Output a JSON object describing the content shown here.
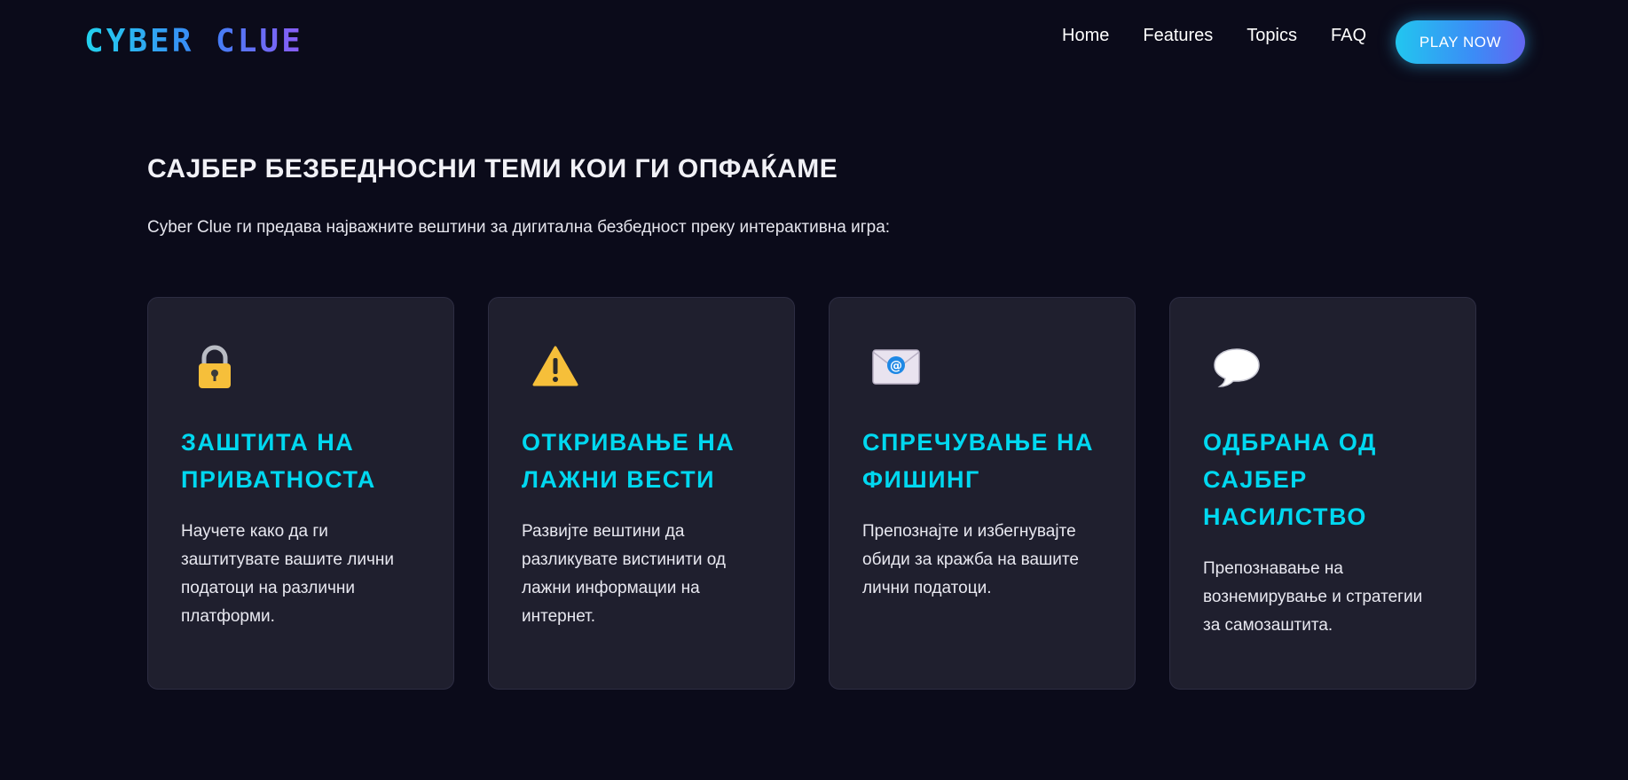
{
  "nav": {
    "logo": "CYBER CLUE",
    "links": [
      "Home",
      "Features",
      "Topics",
      "FAQ"
    ],
    "cta": "PLAY NOW"
  },
  "section": {
    "title": "САЈБЕР БЕЗБЕДНОСНИ ТЕМИ КОИ ГИ ОПФАЌАМЕ",
    "subtitle": "Cyber Clue ги предава најважните вештини за дигитална безбедност преку интерактивна игра:"
  },
  "cards": [
    {
      "icon": "lock-icon",
      "title": "ЗАШТИТА НА ПРИВАТНОСТА",
      "desc": "Научете како да ги заштитувате вашите лични податоци на различни платформи."
    },
    {
      "icon": "warning-icon",
      "title": "ОТКРИВАЊЕ НА ЛАЖНИ ВЕСТИ",
      "desc": "Развијте вештини да разликувате вистинити од лажни информации на интернет."
    },
    {
      "icon": "envelope-icon",
      "title": "СПРЕЧУВАЊЕ НА ФИШИНГ",
      "desc": "Препознајте и избегнувајте обиди за кражба на вашите лични податоци."
    },
    {
      "icon": "speech-bubble-icon",
      "title": "ОДБРАНА ОД САЈБЕР НАСИЛСТВО",
      "desc": "Препознавање на вознемирување и стратегии за самозаштита."
    }
  ],
  "colors": {
    "background": "#0b0b1a",
    "card": "#1f1f2e",
    "accent": "#00d8f0"
  }
}
